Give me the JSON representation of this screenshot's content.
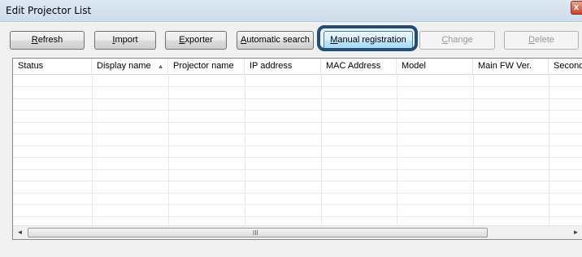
{
  "window": {
    "title": "Edit Projector List",
    "close_label": "x"
  },
  "toolbar": {
    "buttons": [
      {
        "label": "Refresh",
        "mnemonic": "R",
        "state": "normal"
      },
      {
        "label": "Import",
        "mnemonic": "I",
        "state": "normal"
      },
      {
        "label": "Exporter",
        "mnemonic": "E",
        "state": "normal"
      },
      {
        "label": "Automatic search",
        "mnemonic": "A",
        "state": "normal"
      },
      {
        "label": "Manual registration",
        "mnemonic": "M",
        "state": "highlighted"
      },
      {
        "label": "Change",
        "mnemonic": "C",
        "state": "disabled"
      },
      {
        "label": "Delete",
        "mnemonic": "D",
        "state": "disabled"
      }
    ]
  },
  "table": {
    "columns": [
      "Status",
      "Display name",
      "Projector name",
      "IP address",
      "MAC Address",
      "Model",
      "Main FW Ver.",
      "Seconda"
    ],
    "sort_column": "Display name",
    "sort_direction": "ascending",
    "rows": []
  },
  "scrollbar": {
    "left_arrow": "◄",
    "right_arrow": "►",
    "grip": "III"
  },
  "colors": {
    "highlight_ring": "#1f4e79",
    "title_bar": "#d6e3f1",
    "close_button": "#c7432a"
  }
}
